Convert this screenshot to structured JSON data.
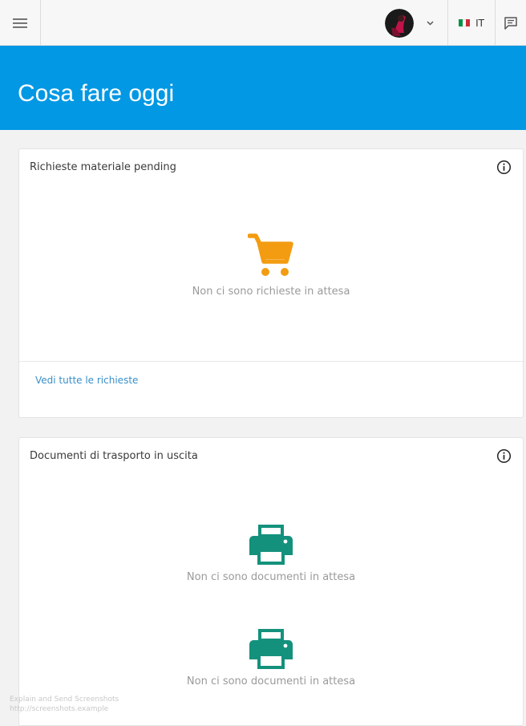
{
  "topbar": {
    "menu_icon": "hamburger-menu-icon",
    "user_menu_icon": "chevron-down-icon",
    "language": {
      "code": "IT",
      "flag_colors": [
        "#009246",
        "#ffffff",
        "#ce2b37"
      ]
    },
    "chat_icon": "chat-icon"
  },
  "header": {
    "title": "Cosa fare oggi",
    "background": "#0398e4"
  },
  "cards": [
    {
      "title": "Richieste materiale pending",
      "info_icon": "info-icon",
      "empty_icon": "shopping-cart-icon",
      "empty_icon_color": "#f39c12",
      "empty_text": "Non ci sono richieste in attesa",
      "link": "Vedi tutte le richieste"
    },
    {
      "title": "Documenti di trasporto in uscita",
      "info_icon": "info-icon",
      "empty_icon": "printer-icon",
      "empty_icon_color": "#14917c",
      "empty_text_1": "Non ci sono documenti in attesa",
      "empty_text_2": "Non ci sono documenti in attesa"
    }
  ],
  "watermark": {
    "line1": "Explain and Send Screenshots",
    "line2": "http://screenshots.example"
  }
}
